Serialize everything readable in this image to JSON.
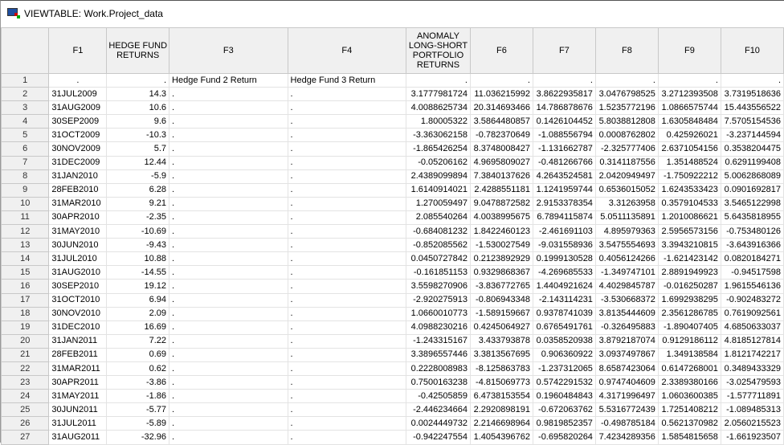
{
  "window": {
    "title": "VIEWTABLE: Work.Project_data"
  },
  "columns": [
    "F1",
    "HEDGE FUND RETURNS",
    "F3",
    "F4",
    "ANOMALY LONG-SHORT PORTFOLIO RETURNS",
    "F6",
    "F7",
    "F8",
    "F9",
    "F10"
  ],
  "rows": [
    [
      "1",
      ".",
      ".",
      "Hedge Fund 2 Return",
      "Hedge Fund 3 Return",
      ".",
      ".",
      ".",
      ".",
      ".",
      "."
    ],
    [
      "2",
      "31JUL2009",
      "14.3",
      ".",
      ".",
      "3.1777981724",
      "11.036215992",
      "3.8622935817",
      "3.0476798525",
      "3.2712393508",
      "3.7319518636"
    ],
    [
      "3",
      "31AUG2009",
      "10.6",
      ".",
      ".",
      "4.0088625734",
      "20.314693466",
      "14.786878676",
      "1.5235772196",
      "1.0866575744",
      "15.443556522"
    ],
    [
      "4",
      "30SEP2009",
      "9.6",
      ".",
      ".",
      "1.80005322",
      "3.5864480857",
      "0.1426104452",
      "5.8038812808",
      "1.6305848484",
      "7.5705154536"
    ],
    [
      "5",
      "31OCT2009",
      "-10.3",
      ".",
      ".",
      "-3.363062158",
      "-0.782370649",
      "-1.088556794",
      "0.0008762802",
      "0.425926021",
      "-3.237144594"
    ],
    [
      "6",
      "30NOV2009",
      "5.7",
      ".",
      ".",
      "-1.865426254",
      "8.3748008427",
      "-1.131662787",
      "-2.325777406",
      "2.6371054156",
      "0.3538204475"
    ],
    [
      "7",
      "31DEC2009",
      "12.44",
      ".",
      ".",
      "-0.05206162",
      "4.9695809027",
      "-0.481266766",
      "0.3141187556",
      "1.351488524",
      "0.6291199408"
    ],
    [
      "8",
      "31JAN2010",
      "-5.9",
      ".",
      ".",
      "2.4389099894",
      "7.3840137626",
      "4.2643524581",
      "2.0420949497",
      "-1.750922212",
      "5.0062868089"
    ],
    [
      "9",
      "28FEB2010",
      "6.28",
      ".",
      ".",
      "1.6140914021",
      "2.4288551181",
      "1.1241959744",
      "0.6536015052",
      "1.6243533423",
      "0.0901692817"
    ],
    [
      "10",
      "31MAR2010",
      "9.21",
      ".",
      ".",
      "1.270059497",
      "9.0478872582",
      "2.9153378354",
      "3.31263958",
      "0.3579104533",
      "3.5465122998"
    ],
    [
      "11",
      "30APR2010",
      "-2.35",
      ".",
      ".",
      "2.085540264",
      "4.0038995675",
      "6.7894115874",
      "5.0511135891",
      "1.2010086621",
      "5.6435818955"
    ],
    [
      "12",
      "31MAY2010",
      "-10.69",
      ".",
      ".",
      "-0.684081232",
      "1.8422460123",
      "-2.461691103",
      "4.895979363",
      "2.5956573156",
      "-0.753480126"
    ],
    [
      "13",
      "30JUN2010",
      "-9.43",
      ".",
      ".",
      "-0.852085562",
      "-1.530027549",
      "-9.031558936",
      "3.5475554693",
      "3.3943210815",
      "-3.643916366"
    ],
    [
      "14",
      "31JUL2010",
      "10.88",
      ".",
      ".",
      "0.0450727842",
      "0.2123892929",
      "0.1999130528",
      "0.4056124266",
      "-1.621423142",
      "0.0820184271"
    ],
    [
      "15",
      "31AUG2010",
      "-14.55",
      ".",
      ".",
      "-0.161851153",
      "0.9329868367",
      "-4.269685533",
      "-1.349747101",
      "2.8891949923",
      "-0.94517598"
    ],
    [
      "16",
      "30SEP2010",
      "19.12",
      ".",
      ".",
      "3.5598270906",
      "-3.836772765",
      "1.4404921624",
      "4.4029845787",
      "-0.016250287",
      "1.9615546136"
    ],
    [
      "17",
      "31OCT2010",
      "6.94",
      ".",
      ".",
      "-2.920275913",
      "-0.806943348",
      "-2.143114231",
      "-3.530668372",
      "1.6992938295",
      "-0.902483272"
    ],
    [
      "18",
      "30NOV2010",
      "2.09",
      ".",
      ".",
      "1.0660010773",
      "-1.589159667",
      "0.9378741039",
      "3.8135444609",
      "2.3561286785",
      "0.7619092561"
    ],
    [
      "19",
      "31DEC2010",
      "16.69",
      ".",
      ".",
      "4.0988230216",
      "0.4245064927",
      "0.6765491761",
      "-0.326495883",
      "-1.890407405",
      "4.6850633037"
    ],
    [
      "20",
      "31JAN2011",
      "7.22",
      ".",
      ".",
      "-1.243315167",
      "3.433793878",
      "0.0358520938",
      "3.8792187074",
      "0.9129186112",
      "4.8185127814"
    ],
    [
      "21",
      "28FEB2011",
      "0.69",
      ".",
      ".",
      "3.3896557446",
      "3.3813567695",
      "0.906360922",
      "3.0937497867",
      "1.349138584",
      "1.8121742217"
    ],
    [
      "22",
      "31MAR2011",
      "0.62",
      ".",
      ".",
      "0.2228008983",
      "-8.125863783",
      "-1.237312065",
      "8.6587423064",
      "0.6147268001",
      "0.3489433329"
    ],
    [
      "23",
      "30APR2011",
      "-3.86",
      ".",
      ".",
      "0.7500163238",
      "-4.815069773",
      "0.5742291532",
      "0.9747404609",
      "2.3389380166",
      "-3.025479593"
    ],
    [
      "24",
      "31MAY2011",
      "-1.86",
      ".",
      ".",
      "-0.42505859",
      "6.4738153554",
      "0.1960484843",
      "4.3171996497",
      "1.0603600385",
      "-1.577711891"
    ],
    [
      "25",
      "30JUN2011",
      "-5.77",
      ".",
      ".",
      "-2.446234664",
      "2.2920898191",
      "-0.672063762",
      "5.5316772439",
      "1.7251408212",
      "-1.089485313"
    ],
    [
      "26",
      "31JUL2011",
      "-5.89",
      ".",
      ".",
      "0.0024449732",
      "2.2146698964",
      "0.9819852357",
      "-0.498785184",
      "0.5621370982",
      "2.0560215523"
    ],
    [
      "27",
      "31AUG2011",
      "-32.96",
      ".",
      ".",
      "-0.942247554",
      "1.4054396762",
      "-0.695820264",
      "7.4234289356",
      "1.5854815658",
      "-1.661923507"
    ]
  ]
}
